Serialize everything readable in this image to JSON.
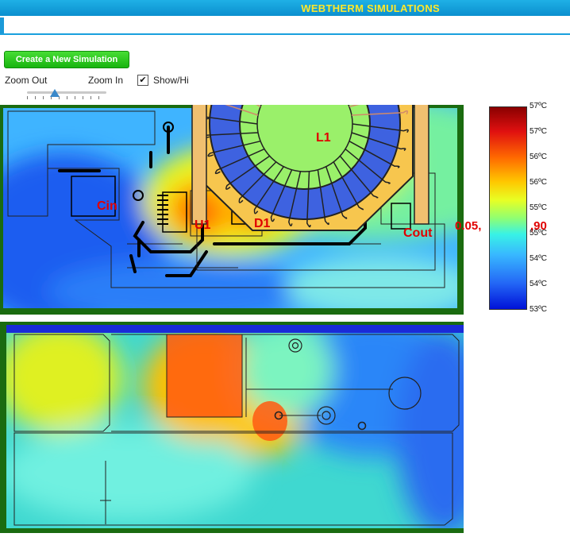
{
  "header": {
    "title": "WEBTHERM SIMULATIONS"
  },
  "toolbar": {
    "create_label": "Create a New Simulation",
    "zoom_out_label": "Zoom Out",
    "zoom_in_label": "Zoom In",
    "show_label": "Show/Hi",
    "show_checked": true,
    "zoom_level": 0.35
  },
  "colors": {
    "header": "#0b8fce",
    "header_text": "#ffe82a",
    "button": "#17b40e",
    "board_edge": "#1a6b10",
    "label": "#e00000"
  },
  "top_view": {
    "labels": {
      "l1": "L1",
      "cin": "Cin",
      "u1": "U1",
      "d1": "D1",
      "cout": "Cout"
    },
    "coord_left": "0.05,",
    "coord_right": ",90"
  },
  "color_scale": {
    "labels": [
      "57ºC",
      "57ºC",
      "56ºC",
      "56ºC",
      "55ºC",
      "55ºC",
      "54ºC",
      "54ºC",
      "53ºC"
    ]
  }
}
